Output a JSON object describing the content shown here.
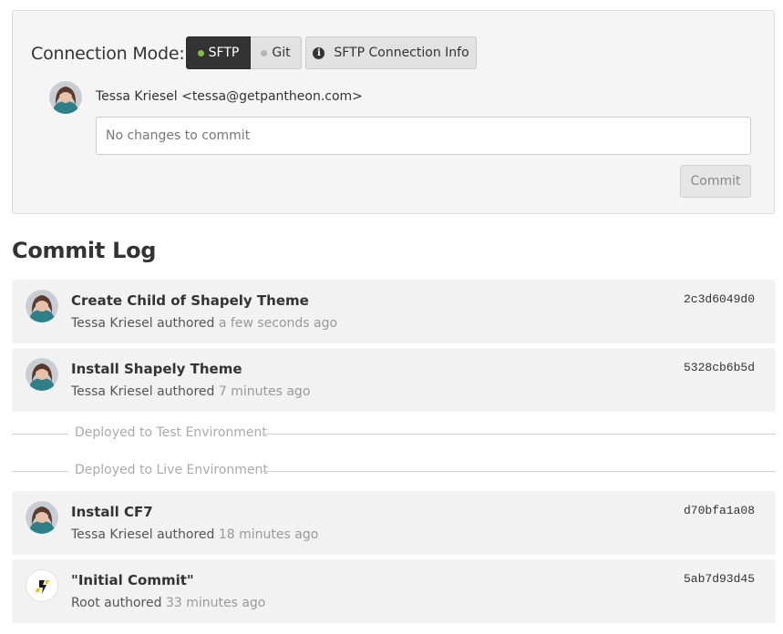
{
  "connection": {
    "label": "Connection Mode:",
    "sftp_label": "SFTP",
    "git_label": "Git",
    "info_label": "SFTP Connection Info"
  },
  "author": {
    "line": "Tessa Kriesel <tessa@getpantheon.com>"
  },
  "commit_form": {
    "placeholder": "No changes to commit",
    "button_label": "Commit"
  },
  "log": {
    "title": "Commit Log",
    "commits": [
      {
        "message": "Create Child of Shapely Theme",
        "author": "Tessa Kriesel",
        "verb": "authored",
        "when": "a few seconds ago",
        "hash": "2c3d6049d0"
      },
      {
        "message": "Install Shapely Theme",
        "author": "Tessa Kriesel",
        "verb": "authored",
        "when": "7 minutes ago",
        "hash": "5328cb6b5d"
      },
      {
        "message": "Install CF7",
        "author": "Tessa Kriesel",
        "verb": "authored",
        "when": "18 minutes ago",
        "hash": "d70bfa1a08"
      },
      {
        "message": "\"Initial Commit\"",
        "author": "Root",
        "verb": "authored",
        "when": "33 minutes ago",
        "hash": "5ab7d93d45"
      }
    ],
    "deploys": [
      {
        "label": "Deployed to Test Environment"
      },
      {
        "label": "Deployed to Live Environment"
      }
    ]
  },
  "colors": {
    "active_mode": "#333333",
    "mode_dot_active": "#7cc242",
    "mode_dot_inactive": "#b5b5b5",
    "panel_bg": "#f5f5f5",
    "row_bg": "#f2f2f2"
  },
  "icons": {
    "info": "info-circle-icon",
    "user_avatar": "user-avatar",
    "root_avatar": "pantheon-logo-icon"
  }
}
